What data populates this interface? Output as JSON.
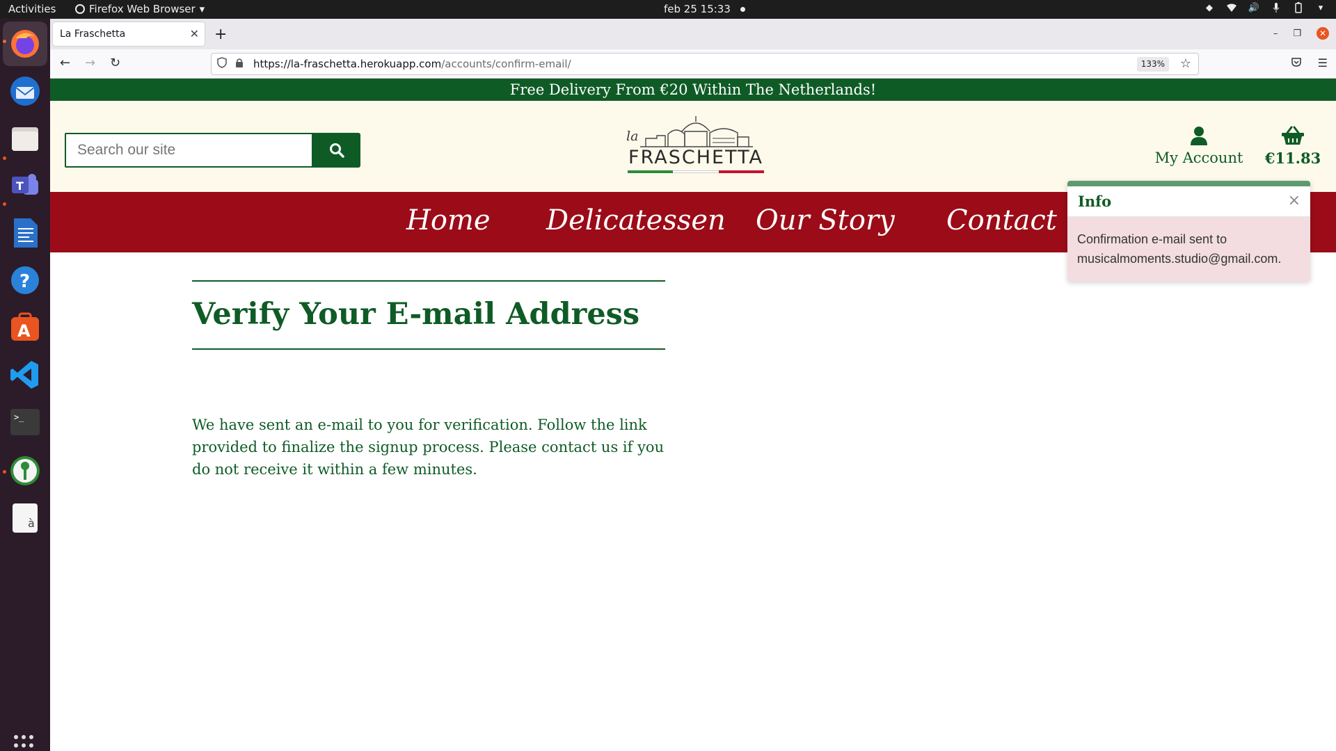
{
  "os": {
    "activities": "Activities",
    "app_menu": "Firefox Web Browser",
    "clock": "feb 25  15:33"
  },
  "browser": {
    "tab_title": "La Fraschetta",
    "url_host": "https://la-fraschetta.herokuapp.com",
    "url_path": "/accounts/confirm-email/",
    "zoom": "133%"
  },
  "site": {
    "promo": "Free Delivery From €20 Within The Netherlands!",
    "search_placeholder": "Search our site",
    "logo_small": "la",
    "logo_text": "FRASCHETTA",
    "account_label": "My Account",
    "cart_total": "€11.83",
    "nav": [
      "Home",
      "Delicatessen",
      "Our Story",
      "Contact"
    ],
    "brand_colors": {
      "green": "#0f5b26",
      "red": "#9b0c18",
      "cream": "#fdfaec"
    }
  },
  "main": {
    "title": "Verify Your E-mail Address",
    "body": "We have sent an e-mail to you for verification. Follow the link provided to finalize the signup process. Please contact us if you do not receive it within a few minutes."
  },
  "toast": {
    "title": "Info",
    "close": "×",
    "message_line1": "Confirmation e-mail sent to",
    "message_line2": "musicalmoments.studio@gmail.com."
  }
}
